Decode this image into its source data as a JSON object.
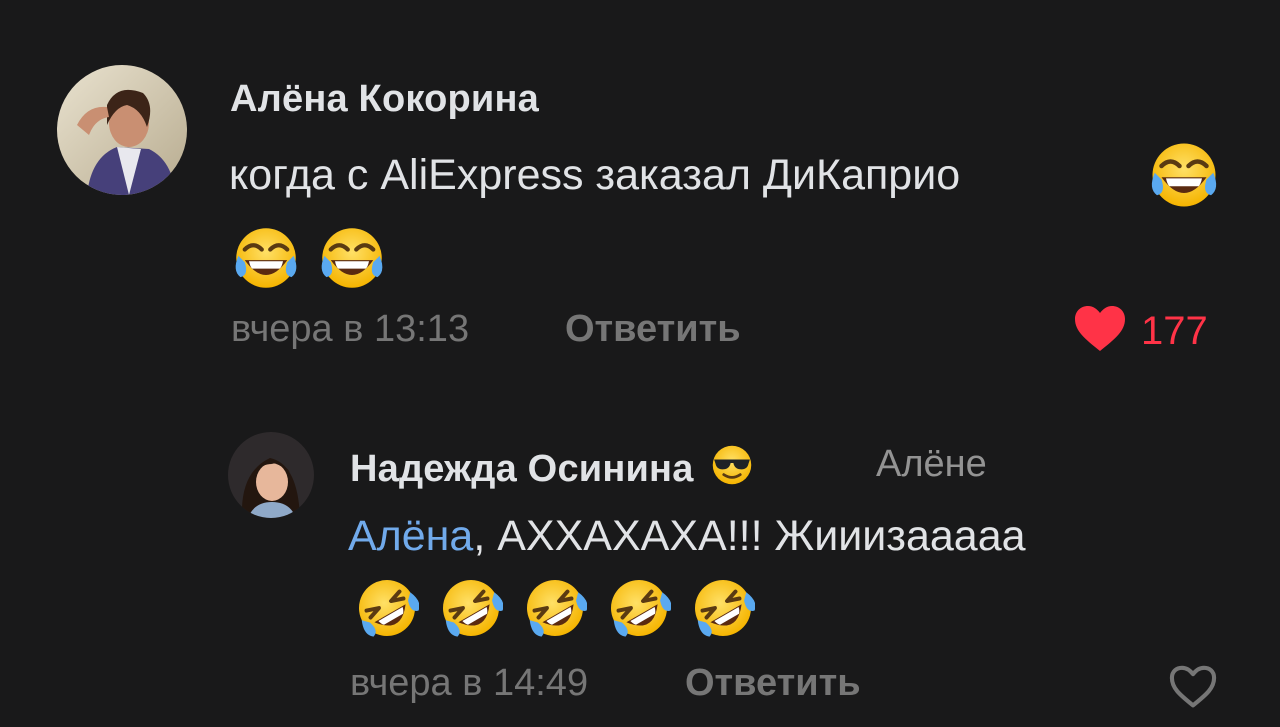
{
  "comments": [
    {
      "author": "Алёна Кокорина",
      "text": "когда с AliExpress заказал ДиКаприо",
      "emoji_inline": "tears-of-joy-emoji",
      "emoji_row": [
        "tears-of-joy-emoji",
        "tears-of-joy-emoji"
      ],
      "time": "вчера в 13:13",
      "reply_label": "Ответить",
      "likes": "177",
      "liked": true
    },
    {
      "author": "Надежда Осинина",
      "author_emoji": "sunglasses-emoji",
      "reply_to": "Алёне",
      "mention": "Алёна",
      "text": ", АХХАХАХА!!! Жииизааааа",
      "emoji_row": [
        "rofl-emoji",
        "rofl-emoji",
        "rofl-emoji",
        "rofl-emoji",
        "rofl-emoji"
      ],
      "time": "вчера в 14:49",
      "reply_label": "Ответить",
      "liked": false
    }
  ],
  "colors": {
    "background": "#19191a",
    "text": "#e1e3e6",
    "secondary": "#767676",
    "link": "#71aaeb",
    "like_active": "#ff3347"
  }
}
